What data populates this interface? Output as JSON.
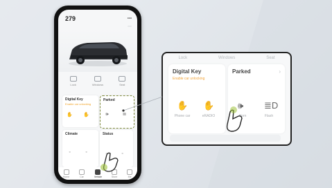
{
  "phone": {
    "battery_pct": "279",
    "signal": "▪▪▪",
    "miles": "",
    "badge": "",
    "quick": [
      {
        "label": "Lock",
        "icon": "lock-icon"
      },
      {
        "label": "Windows",
        "icon": "window-icon"
      },
      {
        "label": "Seat",
        "icon": "seat-icon"
      }
    ],
    "digital_key": {
      "title": "Digital Key",
      "subtitle": "Enable car unlocking"
    },
    "parked": {
      "title": "Parked"
    },
    "climate": {
      "title": "Climate"
    },
    "status_card": {
      "title": "Status"
    },
    "nav": [
      {
        "label": "Home"
      },
      {
        "label": "Car"
      },
      {
        "label": "Vehicle"
      },
      {
        "label": "Store"
      },
      {
        "label": "Me"
      }
    ]
  },
  "zoom": {
    "tabs": [
      "Lock",
      "Windows",
      "Seat"
    ],
    "digital_key": {
      "title": "Digital Key",
      "subtitle": "Enable car unlocking",
      "items": [
        {
          "label": "Phone car",
          "icon": "phone-key-icon"
        },
        {
          "label": "eRADIO",
          "icon": "radio-icon"
        }
      ]
    },
    "parked": {
      "title": "Parked",
      "items": [
        {
          "label": "Horn",
          "icon": "horn-icon"
        },
        {
          "label": "Flash",
          "icon": "headlight-icon"
        }
      ]
    }
  },
  "colors": {
    "accent_orange": "#f1a43a",
    "selection_dash": "#7e8a3c"
  }
}
